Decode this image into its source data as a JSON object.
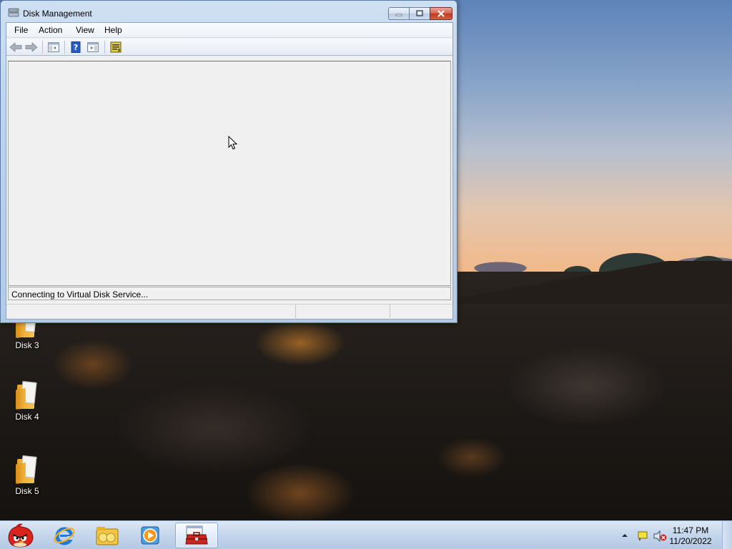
{
  "window": {
    "title": "Disk Management",
    "menu": [
      "File",
      "Action",
      "View",
      "Help"
    ],
    "status_message": "Connecting to Virtual Disk Service..."
  },
  "desktop": {
    "icons": [
      {
        "label": "Disk 3",
        "icon": "folder-icon"
      },
      {
        "label": "Disk 4",
        "icon": "folder-icon"
      },
      {
        "label": "Disk 5",
        "icon": "folder-icon"
      }
    ]
  },
  "taskbar": {
    "apps": [
      {
        "name": "angry-birds-app",
        "icon": "angry-bird-icon"
      },
      {
        "name": "internet-explorer-app",
        "icon": "ie-icon"
      },
      {
        "name": "file-explorer-app",
        "icon": "folder-libraries-icon"
      },
      {
        "name": "media-player-app",
        "icon": "media-player-icon"
      },
      {
        "name": "computer-management-app",
        "icon": "toolbox-icon",
        "active": true
      }
    ],
    "clock": {
      "time": "11:47 PM",
      "date": "11/20/2022"
    }
  },
  "colors": {
    "titlebar": "#bcd2ec",
    "close_button": "#c1381f",
    "client_bg": "#f0f0f0"
  }
}
